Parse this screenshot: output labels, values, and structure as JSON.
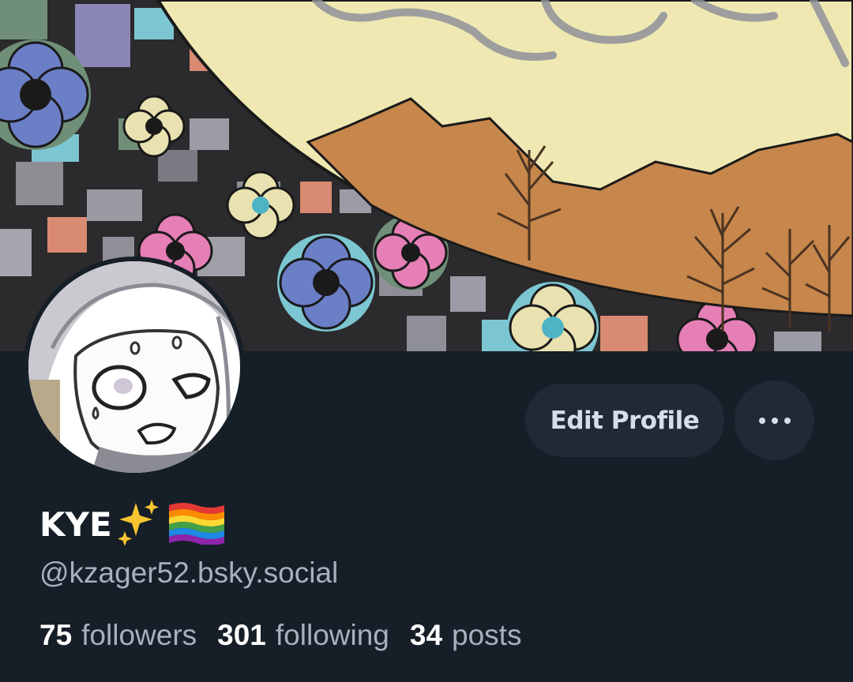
{
  "profile": {
    "display_name": "KYE",
    "name_emojis": [
      "sparkles-emoji",
      "rainbow-flag-emoji"
    ],
    "handle": "@kzager52.bsky.social"
  },
  "actions": {
    "edit_label": "Edit Profile",
    "more_icon": "ellipsis-icon"
  },
  "stats": [
    {
      "value": "75",
      "label": "followers"
    },
    {
      "value": "301",
      "label": "following"
    },
    {
      "value": "34",
      "label": "posts"
    }
  ],
  "colors": {
    "background": "#161e27",
    "button": "#1f2a36",
    "secondary_text": "#a6b1bf",
    "primary_text": "#ffffff"
  }
}
